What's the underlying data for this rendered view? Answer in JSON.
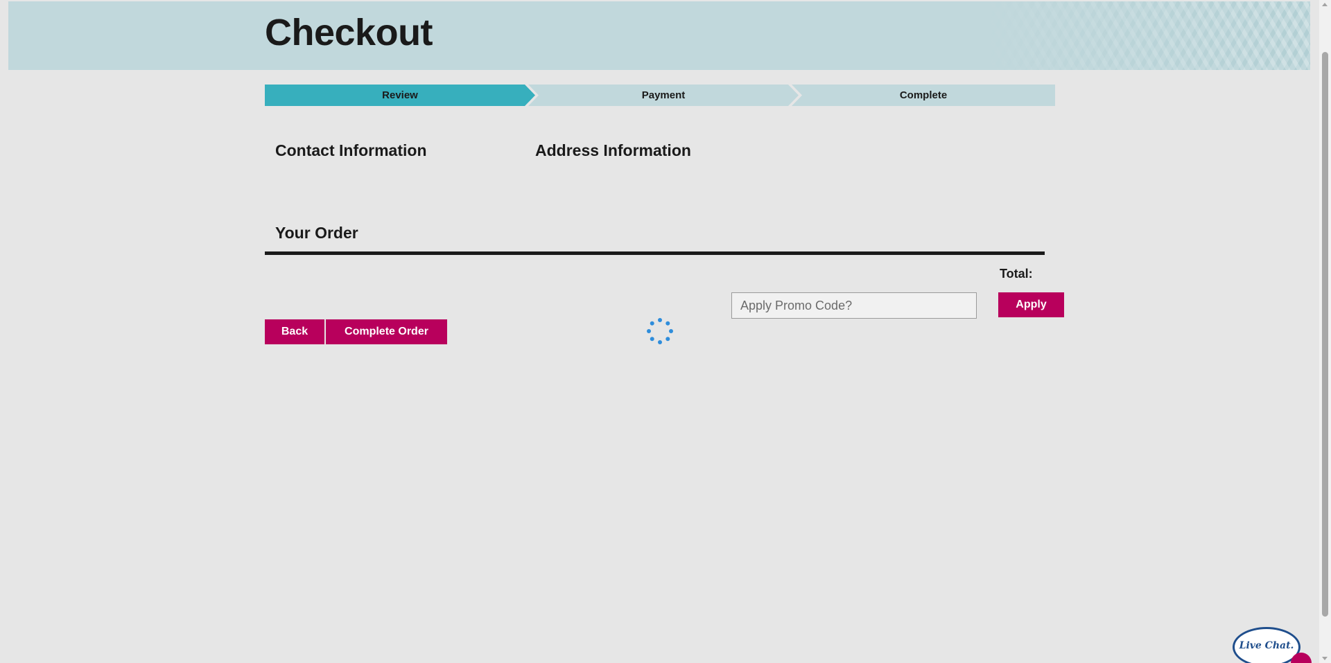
{
  "header": {
    "title": "Checkout"
  },
  "steps": [
    {
      "label": "Review",
      "active": true
    },
    {
      "label": "Payment",
      "active": false
    },
    {
      "label": "Complete",
      "active": false
    }
  ],
  "sections": {
    "contact_heading": "Contact Information",
    "address_heading": "Address Information",
    "order_heading": "Your Order"
  },
  "order": {
    "total_label": "Total:"
  },
  "promo": {
    "placeholder": "Apply Promo Code?",
    "value": "",
    "apply_label": "Apply"
  },
  "actions": {
    "back_label": "Back",
    "complete_label": "Complete Order"
  },
  "chat": {
    "label": "Live Chat."
  },
  "colors": {
    "brand_magenta": "#b8005c",
    "step_active": "#37afbd",
    "step_inactive": "#c1d8dc",
    "header_band": "#c1d8dc",
    "spinner": "#2e8ddb",
    "page_background": "#e6e6e6"
  },
  "icons": {
    "loading": "spinner-icon",
    "chat": "live-chat-icon"
  }
}
